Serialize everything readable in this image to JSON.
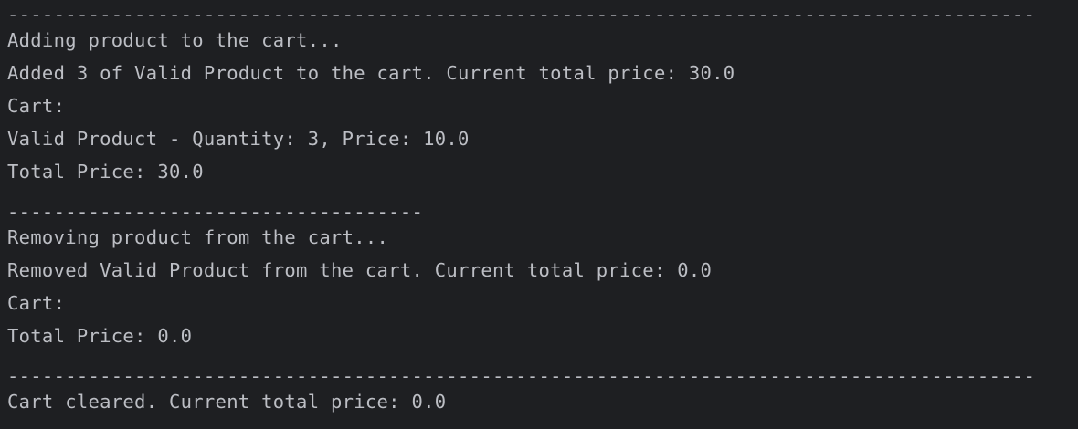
{
  "console": {
    "lines": [
      "-----------------------------------------------------------------------------------------",
      "Adding product to the cart...",
      "Added 3 of Valid Product to the cart. Current total price: 30.0",
      "Cart:",
      "Valid Product - Quantity: 3, Price: 10.0",
      "Total Price: 30.0",
      "------------------------------------",
      "Removing product from the cart...",
      "Removed Valid Product from the cart. Current total price: 0.0",
      "Cart:",
      "Total Price: 0.0",
      "-----------------------------------------------------------------------------------------",
      "Cart cleared. Current total price: 0.0"
    ]
  }
}
